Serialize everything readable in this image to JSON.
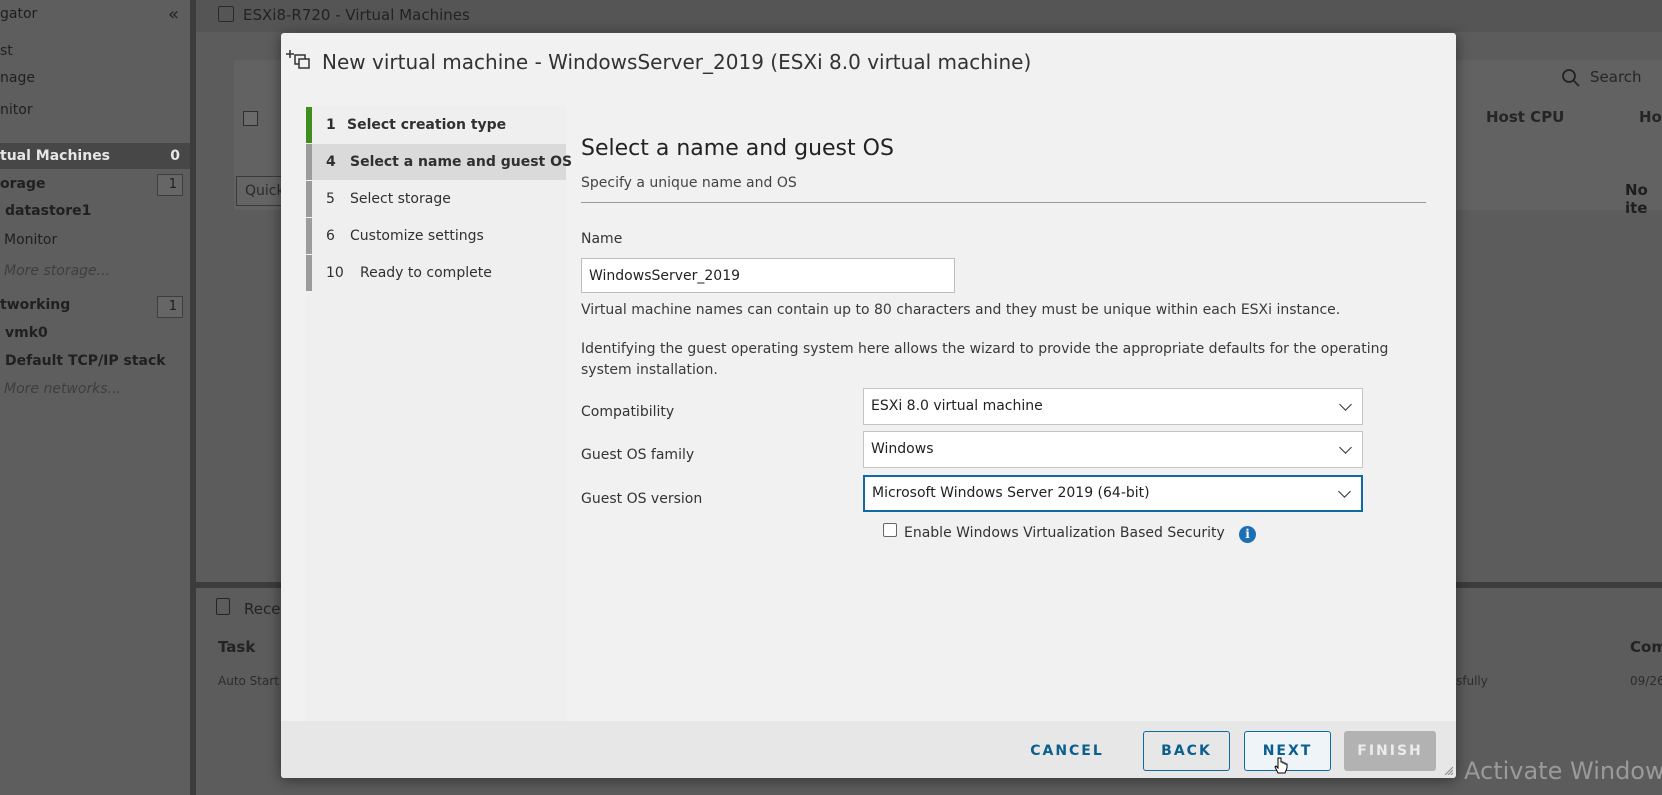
{
  "navigator": {
    "title": "gator",
    "items": [
      {
        "label": "st"
      },
      {
        "label": "nage"
      },
      {
        "label": "nitor"
      }
    ],
    "virtual_machines": {
      "label": "tual Machines",
      "count": "0"
    },
    "storage": {
      "label": "orage",
      "count": "1"
    },
    "datastore": "datastore1",
    "ds_monitor": "Monitor",
    "more_storage": "More storage...",
    "networking": {
      "label": "tworking",
      "count": "1"
    },
    "vmk": "vmk0",
    "tcpip": "Default TCP/IP stack",
    "more_networks": "More networks..."
  },
  "content": {
    "title": "ESXi8-R720 - Virtual Machines",
    "host_cpu_header": "Host CPU",
    "ho_header": "Ho",
    "search_label": "Search",
    "quick_filter": "Quick",
    "no_items": "No ite",
    "recent_tasks_title": "Rece",
    "task_header": "Task",
    "com_header": "Com",
    "auto_start": "Auto Start",
    "status_fragment": "sfully",
    "date_fragment": "09/26"
  },
  "watermark": "Activate Windows",
  "modal": {
    "title": "New virtual machine - WindowsServer_2019 (ESXi 8.0 virtual machine)",
    "steps": [
      {
        "num": "1",
        "label": "Select creation type",
        "state": "done"
      },
      {
        "num": "4",
        "label": "Select a name and guest OS",
        "state": "active"
      },
      {
        "num": "5",
        "label": "Select storage",
        "state": "pending"
      },
      {
        "num": "6",
        "label": "Customize settings",
        "state": "pending"
      },
      {
        "num": "10",
        "label": "Ready to complete",
        "state": "pending"
      }
    ],
    "page_title": "Select a name and guest OS",
    "page_subtitle": "Specify a unique name and OS",
    "name_label": "Name",
    "name_value": "WindowsServer_2019",
    "name_help": "Virtual machine names can contain up to 80 characters and they must be unique within each ESXi instance.",
    "ident_text": "Identifying the guest operating system here allows the wizard to provide the appropriate defaults for the operating system installation.",
    "compatibility_label": "Compatibility",
    "compatibility_value": "ESXi 8.0 virtual machine",
    "os_family_label": "Guest OS family",
    "os_family_value": "Windows",
    "os_version_label": "Guest OS version",
    "os_version_value": "Microsoft Windows Server 2019 (64-bit)",
    "vbs_label": "Enable Windows Virtualization Based Security",
    "vbs_checked": false,
    "info_glyph": "i",
    "buttons": {
      "cancel": "CANCEL",
      "back": "BACK",
      "next": "NEXT",
      "finish": "FINISH"
    }
  },
  "colors": {
    "accent": "#0e6aa0",
    "step_done": "#3e8e1d",
    "info": "#1d6fb5"
  }
}
